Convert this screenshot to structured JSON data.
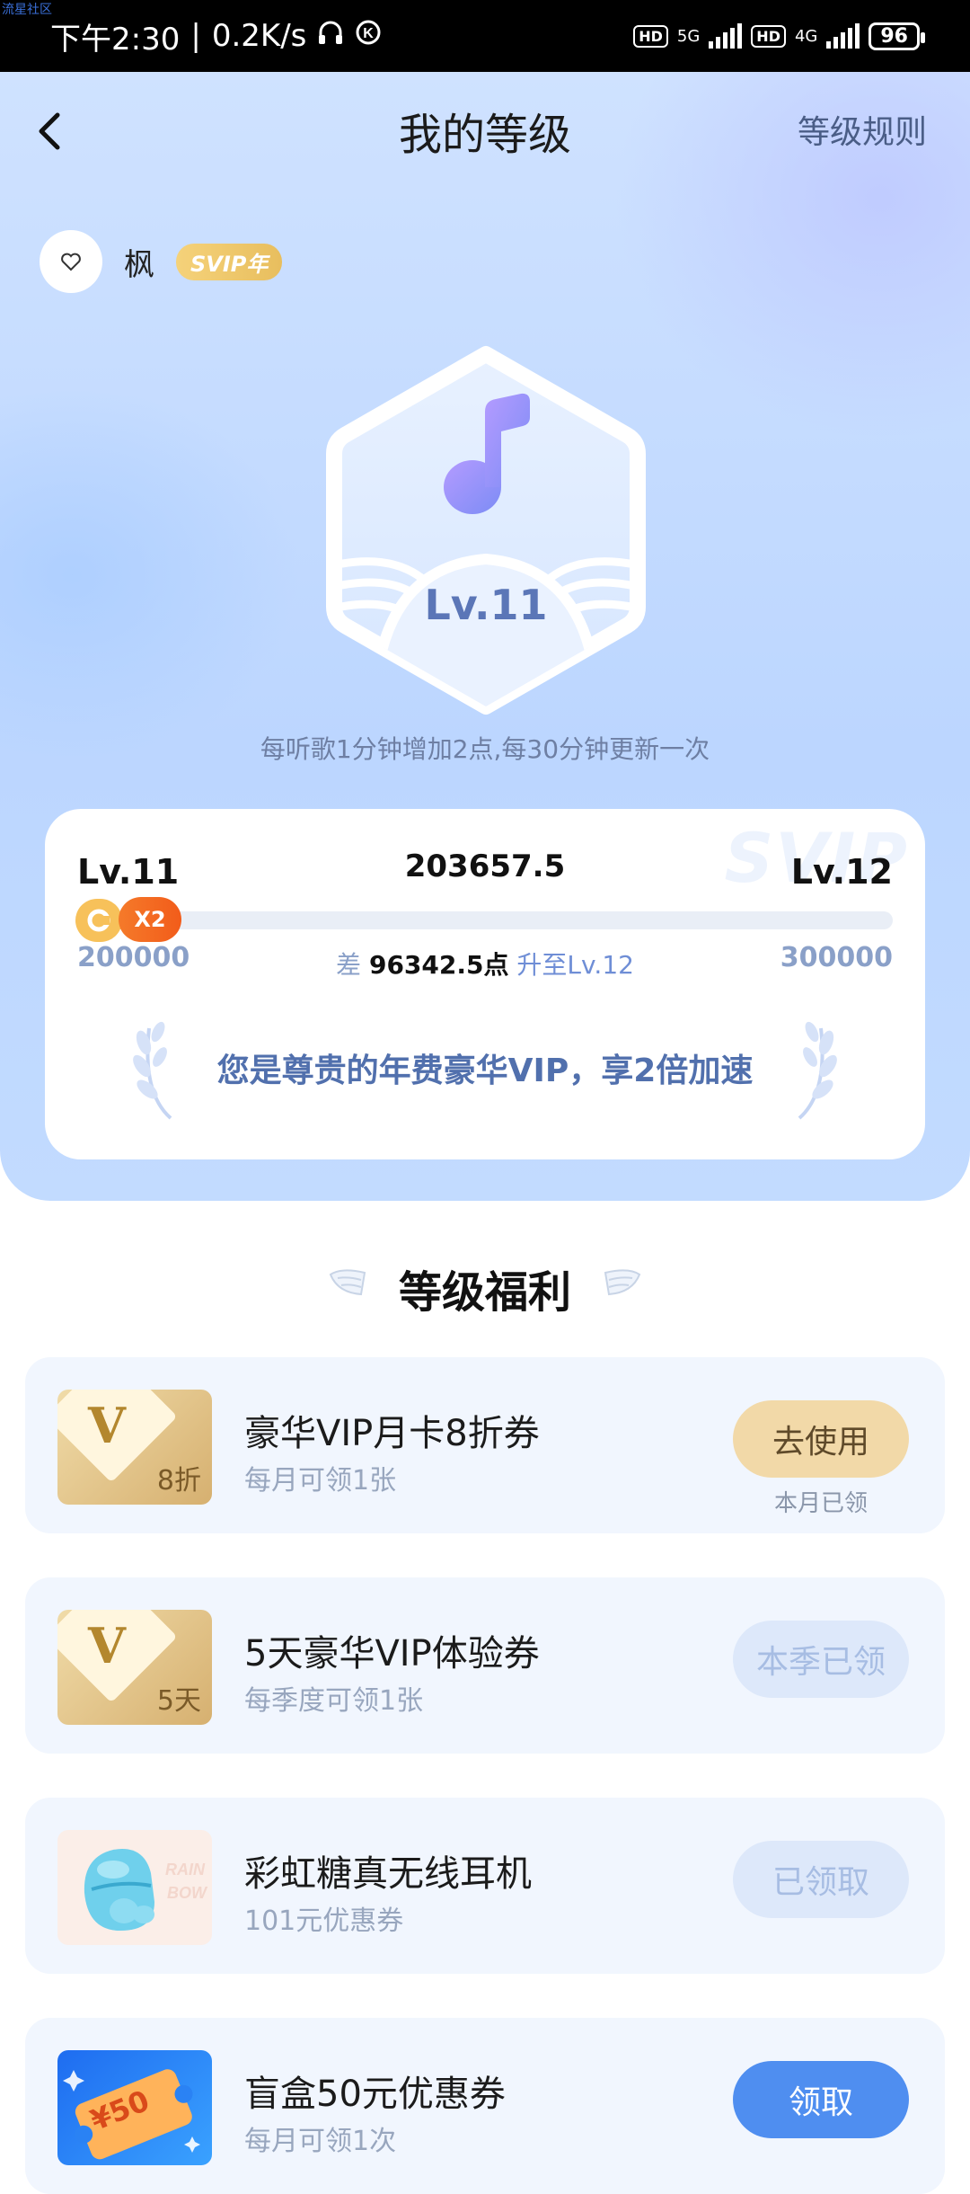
{
  "watermark": "流星社区",
  "status_bar": {
    "time": "下午2:30",
    "speed": "0.2K/s",
    "hd1": "HD",
    "net1": "5G",
    "hd2": "HD",
    "net2": "4G",
    "battery": "96"
  },
  "nav": {
    "title": "我的等级",
    "rules": "等级规则"
  },
  "user": {
    "name": "枫",
    "badge": "SVIP年"
  },
  "level_badge": {
    "label": "Lv.11"
  },
  "tip": "每听歌1分钟增加2点,每30分钟更新一次",
  "progress_card": {
    "current_level": "Lv.11",
    "next_level": "Lv.12",
    "points": "203657.5",
    "start_points": "200000",
    "end_points": "300000",
    "diff_prefix": "差",
    "diff_value": "96342.5点",
    "diff_suffix": "升至Lv.12",
    "boost": "X2",
    "watermark": "SVIP",
    "progress_fraction": 0.036,
    "message": "您是尊贵的年费豪华VIP，享2倍加速"
  },
  "benefits_title": "等级福利",
  "benefits": [
    {
      "title": "豪华VIP月卡8折券",
      "subtitle": "每月可领1张",
      "thumb_label": "8折",
      "thumb_letter": "V",
      "button": "去使用",
      "note": "本月已领"
    },
    {
      "title": "5天豪华VIP体验券",
      "subtitle": "每季度可领1张",
      "thumb_label": "5天",
      "thumb_letter": "V",
      "button": "本季已领"
    },
    {
      "title": "彩虹糖真无线耳机",
      "subtitle": "101元优惠券",
      "button": "已领取"
    },
    {
      "title": "盲盒50元优惠券",
      "subtitle": "每月可领1次",
      "thumb_label": "¥50",
      "button": "领取"
    }
  ],
  "colors": {
    "accent": "#4f8ef0",
    "gold": "#f2d9a8",
    "vip_text": "#5170ad"
  }
}
